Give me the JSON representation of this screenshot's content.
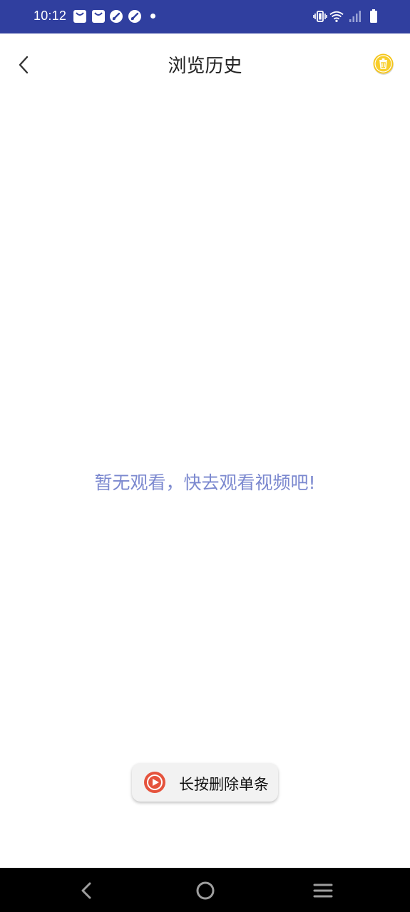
{
  "status_bar": {
    "time": "10:12",
    "background_color": "#303F9F",
    "left_icons": [
      "bag-notification-icon",
      "bag-notification-icon",
      "speed-app-icon",
      "speed-app-icon",
      "more-notifications-dot"
    ],
    "right_icons": [
      "vibrate-icon",
      "wifi-icon",
      "cellular-signal-icon",
      "battery-icon"
    ]
  },
  "app_bar": {
    "back_icon": "chevron-left-icon",
    "title": "浏览历史",
    "delete_icon": "trash-icon",
    "delete_icon_color": "#F5C518"
  },
  "main": {
    "empty_message": "暂无观看，快去观看视频吧!",
    "empty_message_color": "#7B88CF"
  },
  "toast": {
    "icon": "video-play-icon",
    "text": "长按删除单条"
  },
  "nav_bar": {
    "buttons": [
      "back-triangle-icon",
      "home-circle-icon",
      "menu-lines-icon"
    ]
  }
}
